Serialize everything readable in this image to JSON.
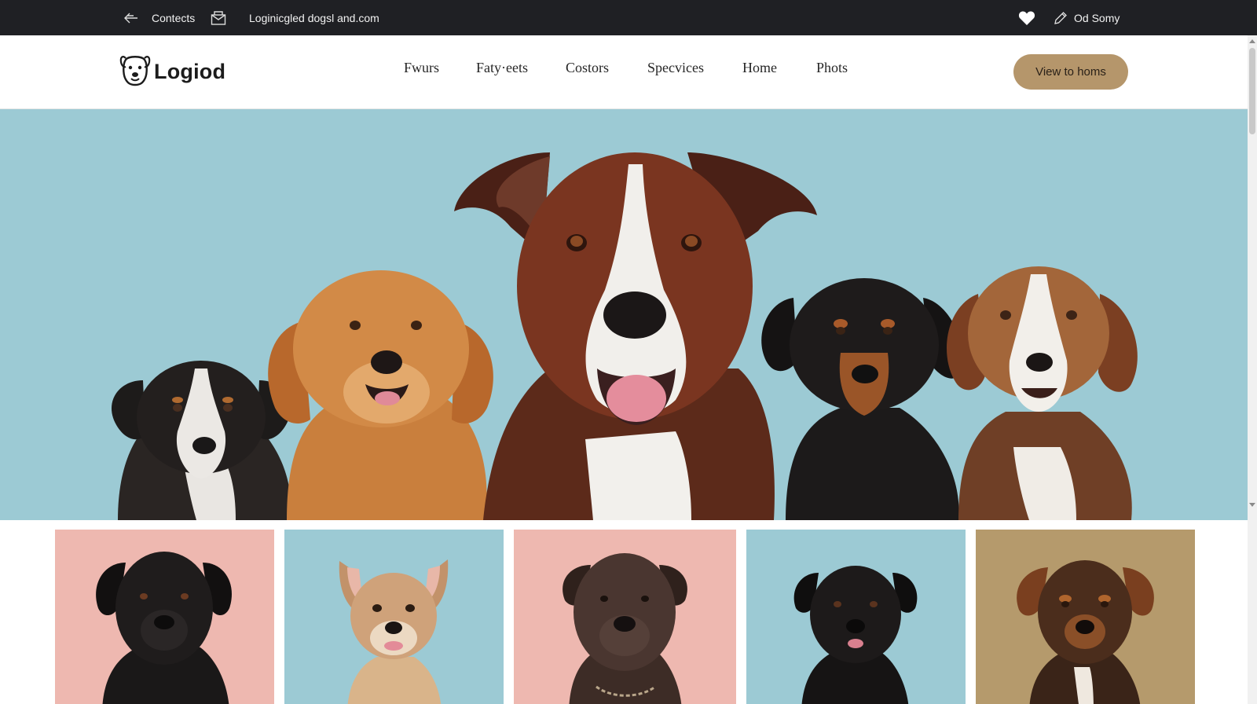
{
  "topbar": {
    "contacts_label": "Contects",
    "site_label": "Loginicgled dogsl and.com",
    "user_label": "Od Somy",
    "icons": [
      "back-arrow-icon",
      "mail-icon",
      "heart-icon",
      "pen-icon"
    ]
  },
  "header": {
    "logo_text": "Logiod",
    "logo_icon": "dog-face-icon",
    "nav": [
      "Fwurs",
      "Faty·eets",
      "Costors",
      "Specvices",
      "Home",
      "Phots"
    ],
    "cta_label": "View to homs"
  },
  "colors": {
    "topbar_bg": "#1f2024",
    "hero_bg": "#9ccad4",
    "cta_bg": "#b5966b",
    "card_pink": "#eeb8b0",
    "card_blue": "#9ccad4",
    "card_tan": "#b59a6c"
  },
  "hero": {
    "dogs": [
      "black-white-dog",
      "golden-retriever",
      "brown-white-pitbull",
      "rottweiler-mix",
      "beagle-mix"
    ]
  },
  "gallery": {
    "cards": [
      {
        "bg": "#eeb8b0",
        "dog": "black-labrador"
      },
      {
        "bg": "#9ccad4",
        "dog": "fawn-chihuahua-mix"
      },
      {
        "bg": "#eeb8b0",
        "dog": "chocolate-mastiff"
      },
      {
        "bg": "#9ccad4",
        "dog": "black-retriever"
      },
      {
        "bg": "#b59a6c",
        "dog": "brindle-hound"
      }
    ]
  }
}
